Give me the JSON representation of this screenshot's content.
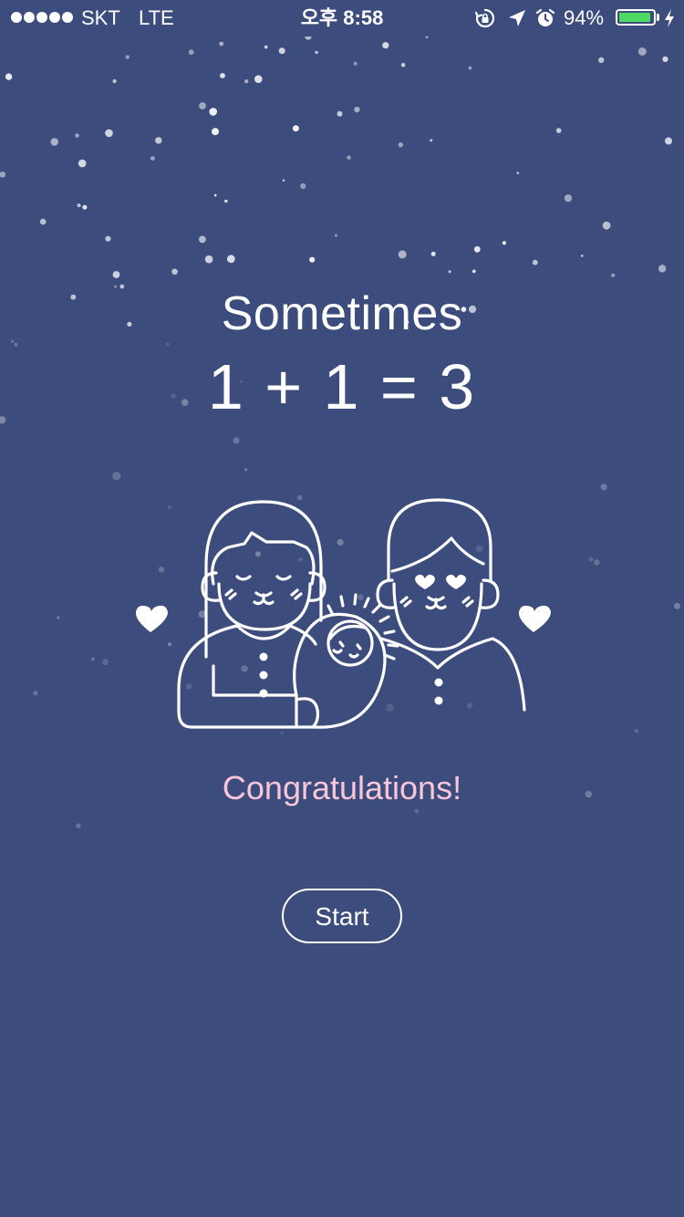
{
  "status_bar": {
    "carrier": "SKT",
    "network": "LTE",
    "time": "오후 8:58",
    "battery_percent": "94%",
    "battery_level": 0.94,
    "icons": [
      "signal-dots-icon",
      "rotation-lock-icon",
      "location-arrow-icon",
      "alarm-clock-icon",
      "battery-icon",
      "charging-bolt-icon"
    ]
  },
  "hero": {
    "title": "Sometimes",
    "equation": "1 + 1 = 3"
  },
  "illustration": {
    "icons": [
      "mother-cat-icon",
      "father-cat-icon",
      "baby-icon",
      "heart-left-icon",
      "heart-right-icon"
    ]
  },
  "message": "Congratulations!",
  "start_button": {
    "label": "Start"
  },
  "colors": {
    "background": "#3c4c7c",
    "accent_pink": "#f7c7d9",
    "battery_green": "#4cd964",
    "line": "#ffffff"
  }
}
